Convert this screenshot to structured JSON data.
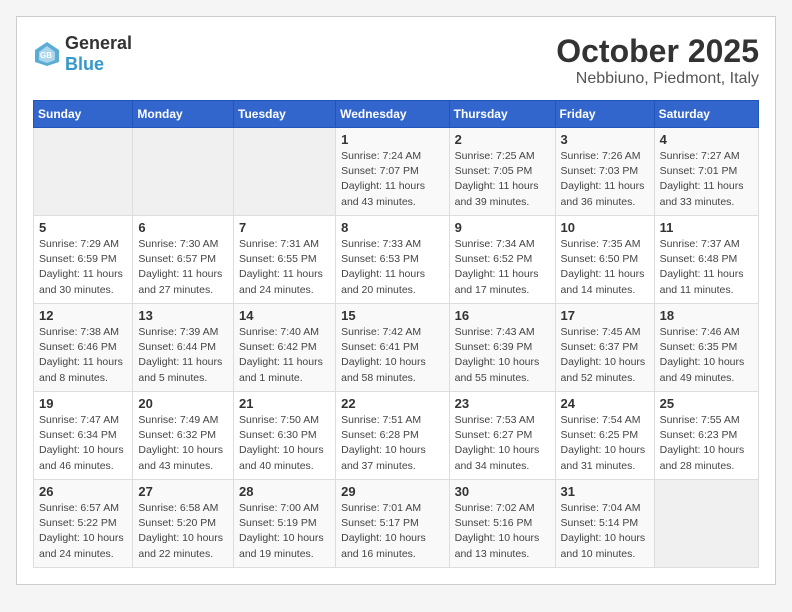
{
  "header": {
    "logo_general": "General",
    "logo_blue": "Blue",
    "month_title": "October 2025",
    "location": "Nebbiuno, Piedmont, Italy"
  },
  "days_of_week": [
    "Sunday",
    "Monday",
    "Tuesday",
    "Wednesday",
    "Thursday",
    "Friday",
    "Saturday"
  ],
  "weeks": [
    [
      {
        "day": "",
        "info": ""
      },
      {
        "day": "",
        "info": ""
      },
      {
        "day": "",
        "info": ""
      },
      {
        "day": "1",
        "info": "Sunrise: 7:24 AM\nSunset: 7:07 PM\nDaylight: 11 hours and 43 minutes."
      },
      {
        "day": "2",
        "info": "Sunrise: 7:25 AM\nSunset: 7:05 PM\nDaylight: 11 hours and 39 minutes."
      },
      {
        "day": "3",
        "info": "Sunrise: 7:26 AM\nSunset: 7:03 PM\nDaylight: 11 hours and 36 minutes."
      },
      {
        "day": "4",
        "info": "Sunrise: 7:27 AM\nSunset: 7:01 PM\nDaylight: 11 hours and 33 minutes."
      }
    ],
    [
      {
        "day": "5",
        "info": "Sunrise: 7:29 AM\nSunset: 6:59 PM\nDaylight: 11 hours and 30 minutes."
      },
      {
        "day": "6",
        "info": "Sunrise: 7:30 AM\nSunset: 6:57 PM\nDaylight: 11 hours and 27 minutes."
      },
      {
        "day": "7",
        "info": "Sunrise: 7:31 AM\nSunset: 6:55 PM\nDaylight: 11 hours and 24 minutes."
      },
      {
        "day": "8",
        "info": "Sunrise: 7:33 AM\nSunset: 6:53 PM\nDaylight: 11 hours and 20 minutes."
      },
      {
        "day": "9",
        "info": "Sunrise: 7:34 AM\nSunset: 6:52 PM\nDaylight: 11 hours and 17 minutes."
      },
      {
        "day": "10",
        "info": "Sunrise: 7:35 AM\nSunset: 6:50 PM\nDaylight: 11 hours and 14 minutes."
      },
      {
        "day": "11",
        "info": "Sunrise: 7:37 AM\nSunset: 6:48 PM\nDaylight: 11 hours and 11 minutes."
      }
    ],
    [
      {
        "day": "12",
        "info": "Sunrise: 7:38 AM\nSunset: 6:46 PM\nDaylight: 11 hours and 8 minutes."
      },
      {
        "day": "13",
        "info": "Sunrise: 7:39 AM\nSunset: 6:44 PM\nDaylight: 11 hours and 5 minutes."
      },
      {
        "day": "14",
        "info": "Sunrise: 7:40 AM\nSunset: 6:42 PM\nDaylight: 11 hours and 1 minute."
      },
      {
        "day": "15",
        "info": "Sunrise: 7:42 AM\nSunset: 6:41 PM\nDaylight: 10 hours and 58 minutes."
      },
      {
        "day": "16",
        "info": "Sunrise: 7:43 AM\nSunset: 6:39 PM\nDaylight: 10 hours and 55 minutes."
      },
      {
        "day": "17",
        "info": "Sunrise: 7:45 AM\nSunset: 6:37 PM\nDaylight: 10 hours and 52 minutes."
      },
      {
        "day": "18",
        "info": "Sunrise: 7:46 AM\nSunset: 6:35 PM\nDaylight: 10 hours and 49 minutes."
      }
    ],
    [
      {
        "day": "19",
        "info": "Sunrise: 7:47 AM\nSunset: 6:34 PM\nDaylight: 10 hours and 46 minutes."
      },
      {
        "day": "20",
        "info": "Sunrise: 7:49 AM\nSunset: 6:32 PM\nDaylight: 10 hours and 43 minutes."
      },
      {
        "day": "21",
        "info": "Sunrise: 7:50 AM\nSunset: 6:30 PM\nDaylight: 10 hours and 40 minutes."
      },
      {
        "day": "22",
        "info": "Sunrise: 7:51 AM\nSunset: 6:28 PM\nDaylight: 10 hours and 37 minutes."
      },
      {
        "day": "23",
        "info": "Sunrise: 7:53 AM\nSunset: 6:27 PM\nDaylight: 10 hours and 34 minutes."
      },
      {
        "day": "24",
        "info": "Sunrise: 7:54 AM\nSunset: 6:25 PM\nDaylight: 10 hours and 31 minutes."
      },
      {
        "day": "25",
        "info": "Sunrise: 7:55 AM\nSunset: 6:23 PM\nDaylight: 10 hours and 28 minutes."
      }
    ],
    [
      {
        "day": "26",
        "info": "Sunrise: 6:57 AM\nSunset: 5:22 PM\nDaylight: 10 hours and 24 minutes."
      },
      {
        "day": "27",
        "info": "Sunrise: 6:58 AM\nSunset: 5:20 PM\nDaylight: 10 hours and 22 minutes."
      },
      {
        "day": "28",
        "info": "Sunrise: 7:00 AM\nSunset: 5:19 PM\nDaylight: 10 hours and 19 minutes."
      },
      {
        "day": "29",
        "info": "Sunrise: 7:01 AM\nSunset: 5:17 PM\nDaylight: 10 hours and 16 minutes."
      },
      {
        "day": "30",
        "info": "Sunrise: 7:02 AM\nSunset: 5:16 PM\nDaylight: 10 hours and 13 minutes."
      },
      {
        "day": "31",
        "info": "Sunrise: 7:04 AM\nSunset: 5:14 PM\nDaylight: 10 hours and 10 minutes."
      },
      {
        "day": "",
        "info": ""
      }
    ]
  ]
}
